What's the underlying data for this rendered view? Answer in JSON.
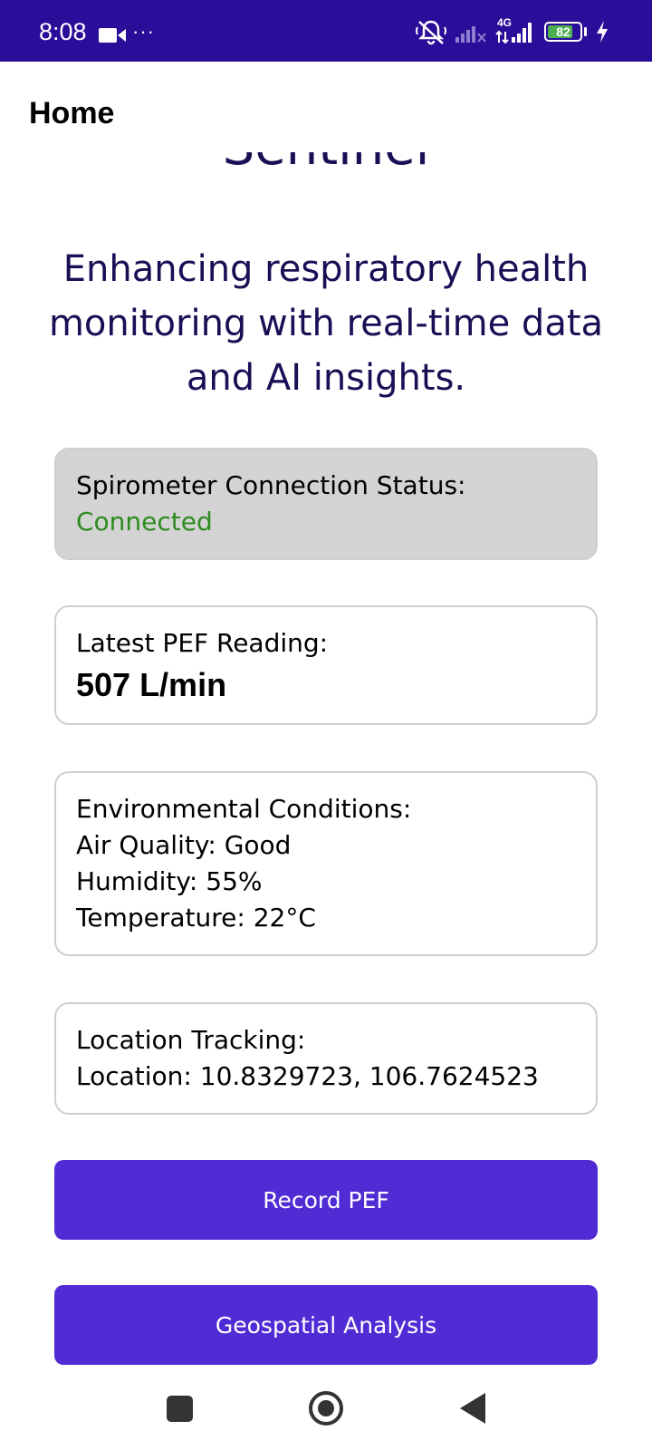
{
  "status_bar": {
    "time": "8:08",
    "overflow_indicator": "···",
    "network_type": "4G",
    "battery_percent": "82",
    "battery_level": 0.82,
    "accent_color": "#2a0e9a"
  },
  "app_bar": {
    "title": "Home"
  },
  "main": {
    "app_name": "Sentinel",
    "tagline": "Enhancing respiratory health monitoring with real-time data and AI insights.",
    "connection": {
      "label": "Spirometer Connection Status:",
      "value": "Connected",
      "value_color": "#2e8b20"
    },
    "pef": {
      "label": "Latest PEF Reading:",
      "value": "507 L/min"
    },
    "environment": {
      "label": "Environmental Conditions:",
      "air_quality": "Air Quality: Good",
      "humidity": "Humidity: 55%",
      "temperature": "Temperature: 22°C"
    },
    "location": {
      "label": "Location Tracking:",
      "value": "Location: 10.8329723, 106.7624523"
    },
    "buttons": {
      "record": "Record PEF",
      "geo": "Geospatial Analysis",
      "color": "#512bd4"
    }
  },
  "nav_bar": {
    "recents_icon": "square-recents-icon",
    "home_icon": "circle-home-icon",
    "back_icon": "triangle-back-icon"
  }
}
